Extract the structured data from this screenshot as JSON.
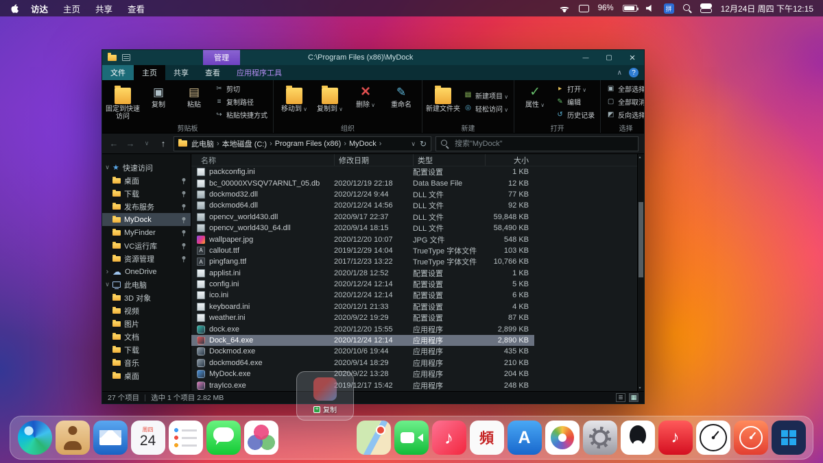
{
  "menubar": {
    "app_menu_items": [
      "访达",
      "主页",
      "共享",
      "查看"
    ],
    "battery_percent": "96%",
    "datetime": "12月24日 周四 下午12:15"
  },
  "explorer": {
    "manage_tab": "管理",
    "title": "C:\\Program Files (x86)\\MyDock",
    "ribbon_tabs": [
      {
        "label": "文件",
        "style": "file"
      },
      {
        "label": "主页",
        "active": true
      },
      {
        "label": "共享"
      },
      {
        "label": "查看"
      },
      {
        "label": "应用程序工具",
        "style": "accent"
      }
    ],
    "ribbon_groups": [
      {
        "label": "剪贴板",
        "large": [
          {
            "label": "固定到快速访问",
            "icon": "pin-folder"
          },
          {
            "label": "复制",
            "icon": "copy"
          },
          {
            "label": "粘贴",
            "icon": "paste"
          }
        ],
        "small": [
          {
            "label": "剪切",
            "icon": "cut"
          },
          {
            "label": "复制路径",
            "icon": "copy-path"
          },
          {
            "label": "粘贴快捷方式",
            "icon": "paste-shortcut"
          }
        ]
      },
      {
        "label": "组织",
        "large": [
          {
            "label": "移动到",
            "icon": "move-to",
            "dd": true
          },
          {
            "label": "复制到",
            "icon": "copy-to",
            "dd": true
          },
          {
            "label": "删除",
            "icon": "delete",
            "dd": true
          },
          {
            "label": "重命名",
            "icon": "rename"
          }
        ],
        "small": []
      },
      {
        "label": "新建",
        "large": [
          {
            "label": "新建文件夹",
            "icon": "new-folder"
          }
        ],
        "small": [
          {
            "label": "新建项目",
            "icon": "new-item",
            "dd": true
          },
          {
            "label": "轻松访问",
            "icon": "easy-access",
            "dd": true
          }
        ]
      },
      {
        "label": "打开",
        "large": [
          {
            "label": "属性",
            "icon": "properties",
            "dd": true
          }
        ],
        "small": [
          {
            "label": "打开",
            "icon": "open",
            "dd": true
          },
          {
            "label": "编辑",
            "icon": "edit"
          },
          {
            "label": "历史记录",
            "icon": "history"
          }
        ]
      },
      {
        "label": "选择",
        "large": [],
        "small": [
          {
            "label": "全部选择",
            "icon": "select-all"
          },
          {
            "label": "全部取消",
            "icon": "select-none"
          },
          {
            "label": "反向选择",
            "icon": "invert-selection"
          }
        ]
      }
    ],
    "breadcrumb": [
      "此电脑",
      "本地磁盘 (C:)",
      "Program Files (x86)",
      "MyDock"
    ],
    "search_placeholder": "搜索\"MyDock\"",
    "sidebar": {
      "quick_access": {
        "label": "快速访问",
        "items": [
          {
            "label": "桌面",
            "pinned": true
          },
          {
            "label": "下载",
            "pinned": true
          },
          {
            "label": "发布服务",
            "pinned": true
          },
          {
            "label": "MyDock",
            "pinned": true,
            "selected": true
          },
          {
            "label": "MyFinder",
            "pinned": true
          },
          {
            "label": "VC运行库",
            "pinned": true
          },
          {
            "label": "资源管理",
            "pinned": true
          }
        ]
      },
      "onedrive": {
        "label": "OneDrive"
      },
      "this_pc": {
        "label": "此电脑",
        "items": [
          {
            "label": "3D 对象"
          },
          {
            "label": "视频"
          },
          {
            "label": "图片"
          },
          {
            "label": "文档"
          },
          {
            "label": "下载"
          },
          {
            "label": "音乐"
          },
          {
            "label": "桌面"
          }
        ]
      }
    },
    "columns": [
      "名称",
      "修改日期",
      "类型",
      "大小"
    ],
    "files": [
      {
        "name": "packconfig.ini",
        "date": "",
        "type": "配置设置",
        "size": "1 KB",
        "kind": "ini"
      },
      {
        "name": "bc_00000XVSQV7ARNLT_05.db",
        "date": "2020/12/19 22:18",
        "type": "Data Base File",
        "size": "12 KB",
        "kind": "db"
      },
      {
        "name": "dockmod32.dll",
        "date": "2020/12/24 9:44",
        "type": "DLL 文件",
        "size": "77 KB",
        "kind": "dll"
      },
      {
        "name": "dockmod64.dll",
        "date": "2020/12/24 14:56",
        "type": "DLL 文件",
        "size": "92 KB",
        "kind": "dll"
      },
      {
        "name": "opencv_world430.dll",
        "date": "2020/9/17 22:37",
        "type": "DLL 文件",
        "size": "59,848 KB",
        "kind": "dll"
      },
      {
        "name": "opencv_world430_64.dll",
        "date": "2020/9/14 18:15",
        "type": "DLL 文件",
        "size": "58,490 KB",
        "kind": "dll"
      },
      {
        "name": "wallpaper.jpg",
        "date": "2020/12/20 10:07",
        "type": "JPG 文件",
        "size": "548 KB",
        "kind": "jpg"
      },
      {
        "name": "callout.ttf",
        "date": "2019/12/29 14:04",
        "type": "TrueType 字体文件",
        "size": "103 KB",
        "kind": "ttf"
      },
      {
        "name": "pingfang.ttf",
        "date": "2017/12/23 13:22",
        "type": "TrueType 字体文件",
        "size": "10,766 KB",
        "kind": "ttf"
      },
      {
        "name": "applist.ini",
        "date": "2020/1/28 12:52",
        "type": "配置设置",
        "size": "1 KB",
        "kind": "ini"
      },
      {
        "name": "config.ini",
        "date": "2020/12/24 12:14",
        "type": "配置设置",
        "size": "5 KB",
        "kind": "ini"
      },
      {
        "name": "ico.ini",
        "date": "2020/12/24 12:14",
        "type": "配置设置",
        "size": "6 KB",
        "kind": "ini"
      },
      {
        "name": "keyboard.ini",
        "date": "2020/12/1 21:33",
        "type": "配置设置",
        "size": "4 KB",
        "kind": "ini"
      },
      {
        "name": "weather.ini",
        "date": "2020/9/22 19:29",
        "type": "配置设置",
        "size": "87 KB",
        "kind": "ini"
      },
      {
        "name": "dock.exe",
        "date": "2020/12/20 15:55",
        "type": "应用程序",
        "size": "2,899 KB",
        "kind": "exe",
        "color": "#2fb7a8"
      },
      {
        "name": "Dock_64.exe",
        "date": "2020/12/24 12:14",
        "type": "应用程序",
        "size": "2,890 KB",
        "kind": "exe",
        "color": "#e05252",
        "selected": true
      },
      {
        "name": "Dockmod.exe",
        "date": "2020/10/6 19:44",
        "type": "应用程序",
        "size": "435 KB",
        "kind": "exe",
        "color": "#8a97a3"
      },
      {
        "name": "dockmod64.exe",
        "date": "2020/9/14 18:29",
        "type": "应用程序",
        "size": "210 KB",
        "kind": "exe",
        "color": "#8a97a3"
      },
      {
        "name": "MyDock.exe",
        "date": "2020/9/22 13:28",
        "type": "应用程序",
        "size": "204 KB",
        "kind": "exe",
        "color": "#4a90d9"
      },
      {
        "name": "trayIco.exe",
        "date": "2019/12/17 15:42",
        "type": "应用程序",
        "size": "248 KB",
        "kind": "exe",
        "color": "#d977b8"
      }
    ],
    "statusbar": {
      "count": "27 个项目",
      "selection": "选中 1 个项目 2.82 MB"
    }
  },
  "drag": {
    "label": "复制"
  },
  "dock": {
    "items": [
      {
        "name": "edge-browser"
      },
      {
        "name": "contacts"
      },
      {
        "name": "mail"
      },
      {
        "name": "calendar",
        "weekday": "周四",
        "day": "24"
      },
      {
        "name": "reminders"
      },
      {
        "name": "messages"
      },
      {
        "name": "game-center"
      },
      {
        "name": "maps"
      },
      {
        "name": "facetime"
      },
      {
        "name": "music"
      },
      {
        "name": "video-app",
        "glyph": "頻"
      },
      {
        "name": "app-store"
      },
      {
        "name": "photos"
      },
      {
        "name": "system-preferences"
      },
      {
        "name": "qq"
      },
      {
        "name": "netease-music"
      },
      {
        "name": "clock"
      },
      {
        "name": "alarm-clock-app"
      },
      {
        "name": "windows-start"
      }
    ]
  }
}
